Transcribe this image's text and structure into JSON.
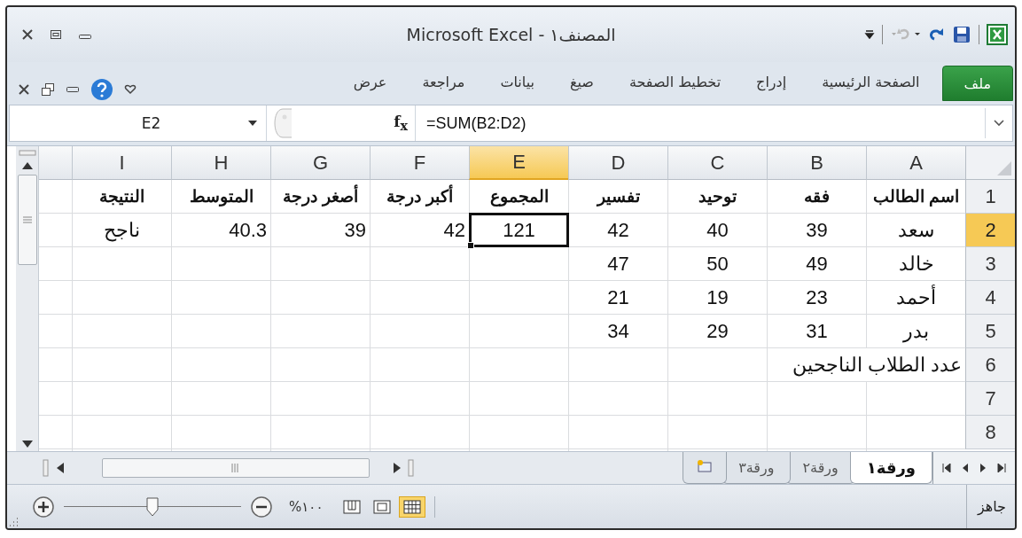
{
  "window": {
    "title": "Microsoft Excel - المصنف١"
  },
  "ribbon_tabs": [
    {
      "label": "ملف",
      "kind": "file",
      "selected": false
    },
    {
      "label": "الصفحة الرئيسية",
      "kind": "tab",
      "selected": false
    },
    {
      "label": "إدراج",
      "kind": "tab",
      "selected": false
    },
    {
      "label": "تخطيط الصفحة",
      "kind": "tab",
      "selected": false
    },
    {
      "label": "صيغ",
      "kind": "tab",
      "selected": false
    },
    {
      "label": "بيانات",
      "kind": "tab",
      "selected": false
    },
    {
      "label": "مراجعة",
      "kind": "tab",
      "selected": false
    },
    {
      "label": "عرض",
      "kind": "tab",
      "selected": false
    }
  ],
  "formula_bar": {
    "name_box": "E2",
    "function_label": "f$_{x}$",
    "formula": "=SUM(B2:D2)"
  },
  "columns": [
    {
      "label": "A",
      "selected": false
    },
    {
      "label": "B",
      "selected": false
    },
    {
      "label": "C",
      "selected": false
    },
    {
      "label": "D",
      "selected": false
    },
    {
      "label": "E",
      "selected": true
    },
    {
      "label": "F",
      "selected": false
    },
    {
      "label": "G",
      "selected": false
    },
    {
      "label": "H",
      "selected": false
    },
    {
      "label": "I",
      "selected": false
    }
  ],
  "rows": [
    {
      "number": "1",
      "selected": false,
      "kind": "header",
      "cells": [
        {
          "text": "اسم الطالب",
          "selected": false
        },
        {
          "text": "فقه",
          "selected": false
        },
        {
          "text": "توحيد",
          "selected": false
        },
        {
          "text": "تفسير",
          "selected": false
        },
        {
          "text": "المجموع",
          "selected": false
        },
        {
          "text": "أكبر درجة",
          "selected": false
        },
        {
          "text": "أصغر درجة",
          "selected": false
        },
        {
          "text": "المتوسط",
          "selected": false
        },
        {
          "text": "النتيجة",
          "selected": false
        }
      ]
    },
    {
      "number": "2",
      "selected": true,
      "kind": "data",
      "cells": [
        {
          "text": "سعد",
          "selected": false
        },
        {
          "text": "39",
          "selected": false
        },
        {
          "text": "40",
          "selected": false
        },
        {
          "text": "42",
          "selected": false
        },
        {
          "text": "121",
          "selected": true
        },
        {
          "text": "42",
          "selected": false,
          "kind": "start"
        },
        {
          "text": "39",
          "selected": false,
          "kind": "start"
        },
        {
          "text": "40.3",
          "selected": false,
          "kind": "start"
        },
        {
          "text": "ناجح",
          "selected": false
        }
      ]
    },
    {
      "number": "3",
      "selected": false,
      "kind": "data",
      "cells": [
        {
          "text": "خالد",
          "selected": false
        },
        {
          "text": "49",
          "selected": false
        },
        {
          "text": "50",
          "selected": false
        },
        {
          "text": "47",
          "selected": false
        },
        null,
        null,
        null,
        null,
        null
      ]
    },
    {
      "number": "4",
      "selected": false,
      "kind": "data",
      "cells": [
        {
          "text": "أحمد",
          "selected": false
        },
        {
          "text": "23",
          "selected": false
        },
        {
          "text": "19",
          "selected": false
        },
        {
          "text": "21",
          "selected": false
        },
        null,
        null,
        null,
        null,
        null
      ]
    },
    {
      "number": "5",
      "selected": false,
      "kind": "data",
      "cells": [
        {
          "text": "بدر",
          "selected": false
        },
        {
          "text": "31",
          "selected": false
        },
        {
          "text": "29",
          "selected": false
        },
        {
          "text": "34",
          "selected": false
        },
        null,
        null,
        null,
        null,
        null
      ]
    },
    {
      "number": "6",
      "selected": false,
      "kind": "data",
      "cells": [
        {
          "text": "عدد الطلاب الناجحين",
          "selected": false,
          "kind": "start"
        },
        null,
        null,
        null,
        null,
        null,
        null,
        null,
        null
      ]
    },
    {
      "number": "7",
      "selected": false,
      "cells": [
        null,
        null,
        null,
        null,
        null,
        null,
        null,
        null,
        null
      ]
    },
    {
      "number": "8",
      "selected": false,
      "cells": [
        null,
        null,
        null,
        null,
        null,
        null,
        null,
        null,
        null
      ]
    }
  ],
  "sheet_tabs": [
    {
      "label": "ورقة١",
      "selected": true
    },
    {
      "label": "ورقة٢",
      "selected": false
    },
    {
      "label": "ورقة٣",
      "selected": false
    }
  ],
  "status_bar": {
    "status": "جاهز",
    "zoom": "%١٠٠",
    "zoom_slider": {
      "level": 0.5
    },
    "views": [
      {
        "kind": "normal",
        "selected": true
      },
      {
        "kind": "layout",
        "selected": false
      },
      {
        "kind": "break",
        "selected": false
      }
    ]
  }
}
